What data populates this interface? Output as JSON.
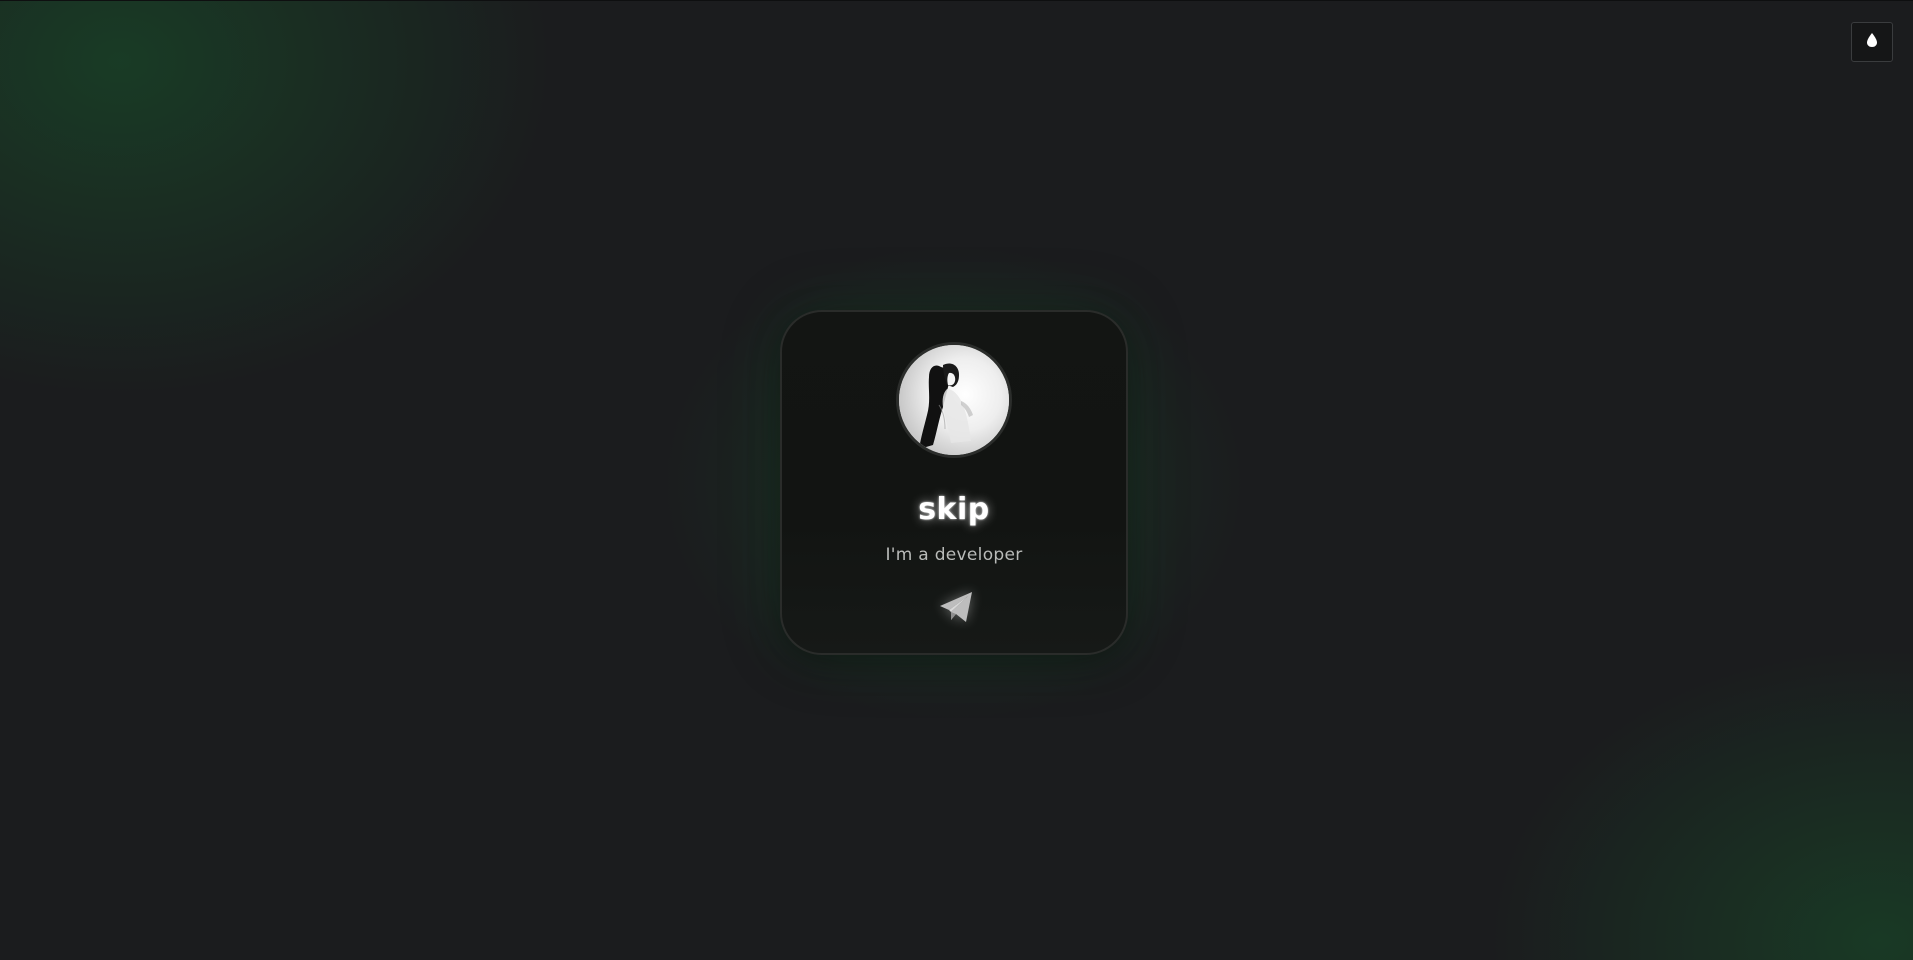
{
  "theme_toggle": {
    "icon": "droplet-icon",
    "color": "#ffffff"
  },
  "profile": {
    "name": "skip",
    "tagline": "I'm a developer",
    "avatar_icon": "avatar"
  },
  "links": [
    {
      "icon": "telegram-icon",
      "color": "#bdbdbd"
    }
  ],
  "colors": {
    "background": "#1b1c1e",
    "accent_glow": "#1e5a32",
    "card_background": "#131513",
    "name_text": "#ffffff",
    "tagline_text": "#b9bbb9"
  }
}
